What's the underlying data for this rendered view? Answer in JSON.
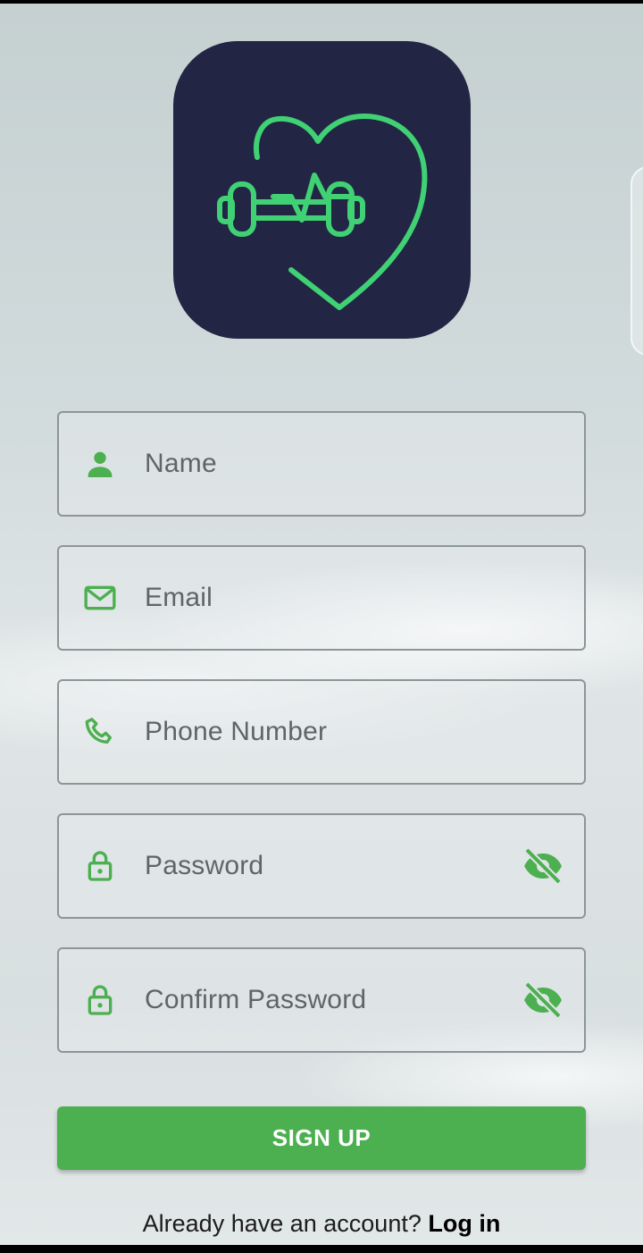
{
  "app": {
    "logo": {
      "icon": "heart-dumbbell-icon",
      "bg_color": "#222544",
      "accent_color": "#3fd173"
    }
  },
  "form": {
    "fields": [
      {
        "placeholder": "Name",
        "value": "",
        "icon": "person-icon"
      },
      {
        "placeholder": "Email",
        "value": "",
        "icon": "mail-icon"
      },
      {
        "placeholder": "Phone Number",
        "value": "",
        "icon": "phone-icon"
      },
      {
        "placeholder": "Password",
        "value": "",
        "icon": "lock-icon",
        "trailing_icon": "eye-off-icon"
      },
      {
        "placeholder": "Confirm Password",
        "value": "",
        "icon": "lock-icon",
        "trailing_icon": "eye-off-icon"
      }
    ],
    "submit_label": "SIGN UP",
    "icon_color": "#4caf50"
  },
  "footer": {
    "prompt": "Already have an account?",
    "link_label": "Log in"
  }
}
